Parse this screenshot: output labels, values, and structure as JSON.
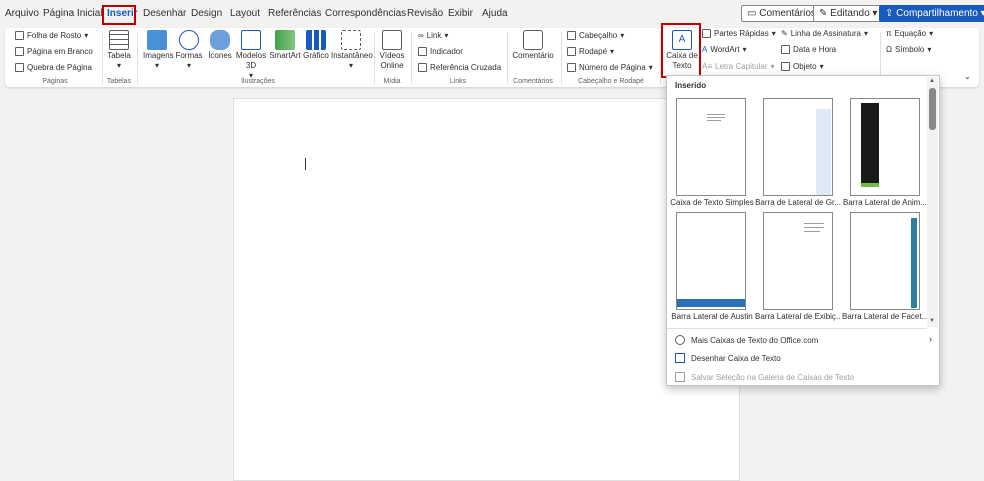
{
  "menu": {
    "tabs": [
      "Arquivo",
      "Página Inicial",
      "Inserir",
      "Desenhar",
      "Design",
      "Layout",
      "Referências",
      "Correspondências",
      "Revisão",
      "Exibir",
      "Ajuda"
    ],
    "active_tab": "Inserir",
    "comments_label": "Comentários",
    "editing_label": "Editando",
    "share_label": "Compartilhamento"
  },
  "ribbon": {
    "paginas": {
      "items": [
        "Folha de Rosto",
        "Página em Branco",
        "Quebra de Página"
      ],
      "label": "Páginas"
    },
    "tabelas": {
      "button": "Tabela",
      "label": "Tabelas"
    },
    "ilustracoes": {
      "buttons": [
        "Imagens",
        "Formas",
        "Ícones",
        "Modelos 3D",
        "SmartArt",
        "Gráfico",
        "Instantâneo"
      ],
      "label": "Ilustrações"
    },
    "midia": {
      "button_line1": "Vídeos",
      "button_line2": "Online",
      "label": "Mídia"
    },
    "links": {
      "items": [
        "Link",
        "Indicador",
        "Referência Cruzada"
      ],
      "label": "Links"
    },
    "comentarios": {
      "button": "Comentário",
      "label": "Comentários"
    },
    "cabecalho": {
      "items": [
        "Cabeçalho",
        "Rodapé",
        "Número de Página"
      ],
      "label": "Cabeçalho e Rodapé"
    },
    "texto": {
      "caixa_line1": "Caixa de",
      "caixa_line2": "Texto",
      "col1": [
        "Partes Rápidas",
        "WordArt",
        "Letra Capitular"
      ],
      "col2": [
        "Linha de Assinatura",
        "Data e Hora",
        "Objeto"
      ]
    },
    "simbolos": {
      "items": [
        "Equação",
        "Símbolo"
      ]
    }
  },
  "dropdown": {
    "section": "Inserido",
    "gallery": [
      "Caixa de Texto Simples",
      "Barra de Lateral de Gr...",
      "Barra Lateral de Anim...",
      "Barra Lateral de Austin",
      "Barra Lateral de Exibiç...",
      "Barra Lateral de Facet..."
    ],
    "menu_items": [
      "Mais Caixas de Texto do Office.com",
      "Desenhar Caixa de Texto",
      "Salvar Seleção na Galeria de Caixas de Texto"
    ]
  }
}
